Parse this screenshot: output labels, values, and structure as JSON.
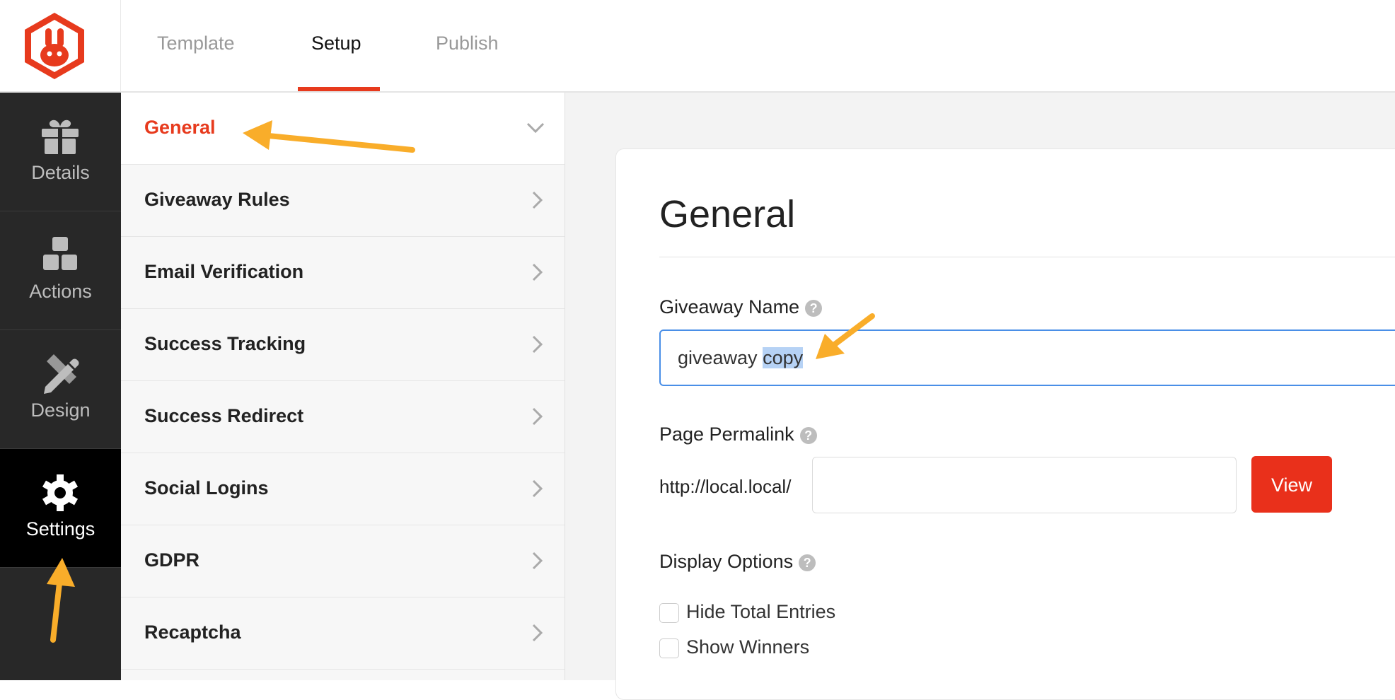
{
  "header": {
    "logo_icon": "rabbit-hexagon-logo-icon",
    "tabs": [
      {
        "label": "Template",
        "active": false
      },
      {
        "label": "Setup",
        "active": true
      },
      {
        "label": "Publish",
        "active": false
      }
    ]
  },
  "sidebar": {
    "items": [
      {
        "label": "Details",
        "icon": "gift-icon",
        "active": false
      },
      {
        "label": "Actions",
        "icon": "cubes-icon",
        "active": false
      },
      {
        "label": "Design",
        "icon": "pencil-ruler-icon",
        "active": false
      },
      {
        "label": "Settings",
        "icon": "gear-icon",
        "active": true
      }
    ]
  },
  "submenu": {
    "items": [
      {
        "label": "General",
        "active": true,
        "icon": "chevron-down-icon"
      },
      {
        "label": "Giveaway Rules",
        "active": false,
        "icon": "chevron-right-icon"
      },
      {
        "label": "Email Verification",
        "active": false,
        "icon": "chevron-right-icon"
      },
      {
        "label": "Success Tracking",
        "active": false,
        "icon": "chevron-right-icon"
      },
      {
        "label": "Success Redirect",
        "active": false,
        "icon": "chevron-right-icon"
      },
      {
        "label": "Social Logins",
        "active": false,
        "icon": "chevron-right-icon"
      },
      {
        "label": "GDPR",
        "active": false,
        "icon": "chevron-right-icon"
      },
      {
        "label": "Recaptcha",
        "active": false,
        "icon": "chevron-right-icon"
      }
    ]
  },
  "main": {
    "title": "General",
    "giveaway_name": {
      "label": "Giveaway Name",
      "value_prefix": "giveaway ",
      "value_selected": "copy",
      "help": "?"
    },
    "permalink": {
      "label": "Page Permalink",
      "prefix": "http://local.local/",
      "value": "",
      "view_label": "View",
      "help": "?"
    },
    "display_options": {
      "label": "Display Options",
      "help": "?",
      "options": [
        {
          "label": "Hide Total Entries",
          "checked": false
        },
        {
          "label": "Show Winners",
          "checked": false
        }
      ]
    }
  },
  "colors": {
    "accent": "#e73a1d",
    "sidebar_bg": "#282828",
    "sidebar_active": "#000000",
    "annotation_arrow": "#f9ad2a",
    "focus_border": "#4a8fe7"
  }
}
